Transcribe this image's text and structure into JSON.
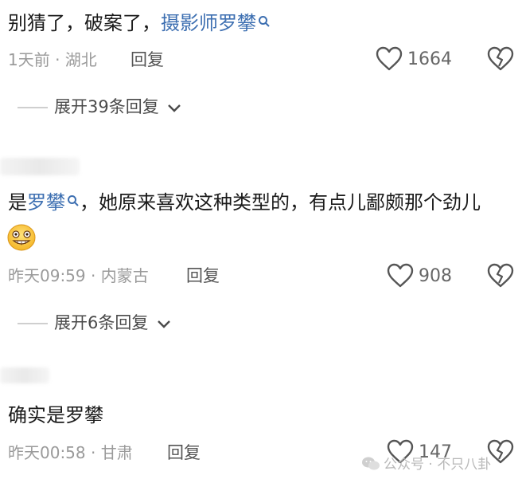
{
  "comments": [
    {
      "text_before": "别猜了，破案了，",
      "link_text": "摄影师罗攀",
      "meta": "1天前 · 湖北",
      "reply_label": "回复",
      "like_count": "1664",
      "expand_label": "展开39条回复"
    },
    {
      "text_before": "是",
      "link_text": "罗攀",
      "text_after": "，她原来喜欢这种类型的，有点儿鄙颇那个劲儿",
      "meta": "昨天09:59 · 内蒙古",
      "reply_label": "回复",
      "like_count": "908",
      "expand_label": "展开6条回复"
    },
    {
      "text": "确实是罗攀",
      "meta": "昨天00:58 · 甘肃",
      "reply_label": "回复",
      "like_count": "147"
    }
  ],
  "watermark": "公众号 · 不只八卦",
  "colors": {
    "link": "#3d6fb1",
    "meta": "#9a9a9a",
    "icon": "#555555"
  }
}
